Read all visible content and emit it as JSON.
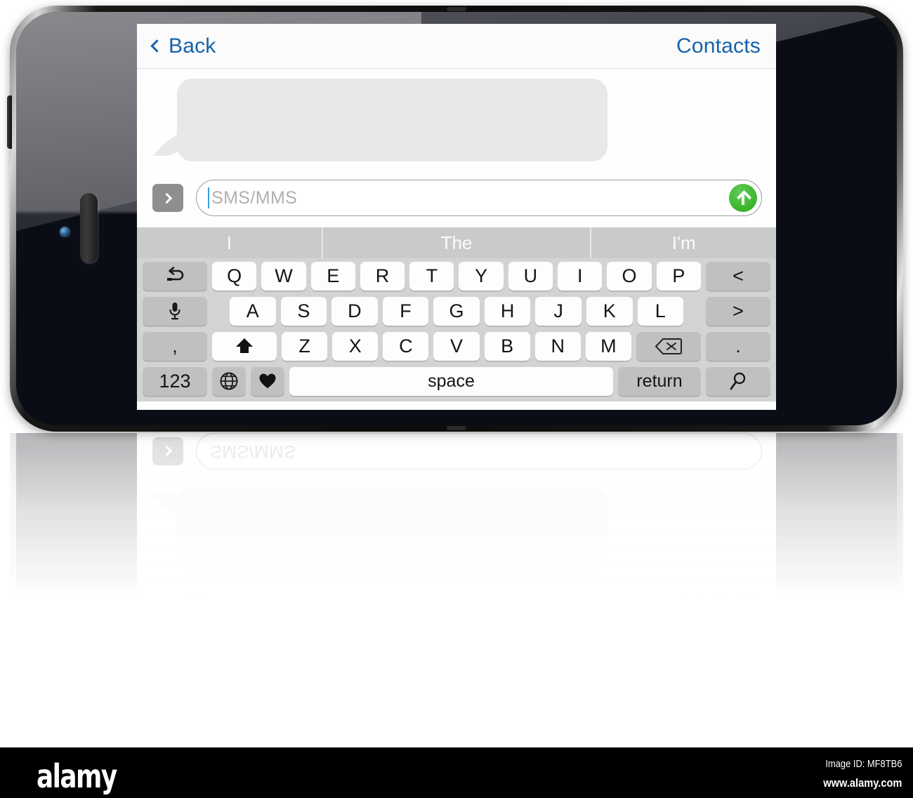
{
  "navbar": {
    "back_label": "Back",
    "back_icon": "chevron-left-icon",
    "contacts_label": "Contacts",
    "accent_color": "#1463ad"
  },
  "conversation": {
    "bubble_placeholder": "",
    "bubble_color": "#e8e8e8"
  },
  "compose": {
    "expand_icon": "chevron-right-icon",
    "placeholder": "SMS/MMS",
    "value": "",
    "send_icon": "arrow-up-circle-icon",
    "send_color": "#3fb82f"
  },
  "keyboard": {
    "suggestions": [
      "I",
      "The",
      "I'm"
    ],
    "row1": [
      {
        "label": "",
        "icon": "undo-arrow-icon",
        "type": "fn-side"
      },
      {
        "label": "Q",
        "type": "letter"
      },
      {
        "label": "W",
        "type": "letter"
      },
      {
        "label": "E",
        "type": "letter"
      },
      {
        "label": "R",
        "type": "letter"
      },
      {
        "label": "T",
        "type": "letter"
      },
      {
        "label": "Y",
        "type": "letter"
      },
      {
        "label": "U",
        "type": "letter"
      },
      {
        "label": "I",
        "type": "letter"
      },
      {
        "label": "O",
        "type": "letter"
      },
      {
        "label": "P",
        "type": "letter"
      },
      {
        "label": "<",
        "type": "fn-side"
      }
    ],
    "row2": [
      {
        "label": "",
        "icon": "microphone-icon",
        "type": "fn-side"
      },
      {
        "label": "A",
        "type": "letter"
      },
      {
        "label": "S",
        "type": "letter"
      },
      {
        "label": "D",
        "type": "letter"
      },
      {
        "label": "F",
        "type": "letter"
      },
      {
        "label": "G",
        "type": "letter"
      },
      {
        "label": "H",
        "type": "letter"
      },
      {
        "label": "J",
        "type": "letter"
      },
      {
        "label": "K",
        "type": "letter"
      },
      {
        "label": "L",
        "type": "letter"
      },
      {
        "label": ">",
        "type": "fn-side"
      }
    ],
    "row3": [
      {
        "label": ",",
        "type": "fn-side"
      },
      {
        "label": "",
        "icon": "shift-up-arrow-icon",
        "type": "shift"
      },
      {
        "label": "Z",
        "type": "letter"
      },
      {
        "label": "X",
        "type": "letter"
      },
      {
        "label": "C",
        "type": "letter"
      },
      {
        "label": "V",
        "type": "letter"
      },
      {
        "label": "B",
        "type": "letter"
      },
      {
        "label": "N",
        "type": "letter"
      },
      {
        "label": "M",
        "type": "letter"
      },
      {
        "label": "",
        "icon": "backspace-icon",
        "type": "backspace"
      },
      {
        "label": ".",
        "type": "fn-side"
      }
    ],
    "row4": [
      {
        "label": "123",
        "type": "fn-side"
      },
      {
        "label": "",
        "icon": "globe-icon",
        "type": "fn-half"
      },
      {
        "label": "",
        "icon": "heart-icon",
        "type": "fn-half"
      },
      {
        "label": "space",
        "type": "space"
      },
      {
        "label": "return",
        "type": "return"
      },
      {
        "label": "",
        "icon": "magnifier-icon",
        "type": "fn-side"
      }
    ],
    "bg_color": "#d2d4d3",
    "key_color": "#fdfdfd",
    "fn_key_color": "#bfc1c0"
  },
  "device": {
    "body_color": "#0b0d16",
    "camera_icon": "camera-lens-icon",
    "speaker_icon": "earpiece-speaker-icon"
  },
  "watermark": {
    "logo": "alamy",
    "image_id": "Image ID: MF8TB6",
    "url": "www.alamy.com"
  }
}
